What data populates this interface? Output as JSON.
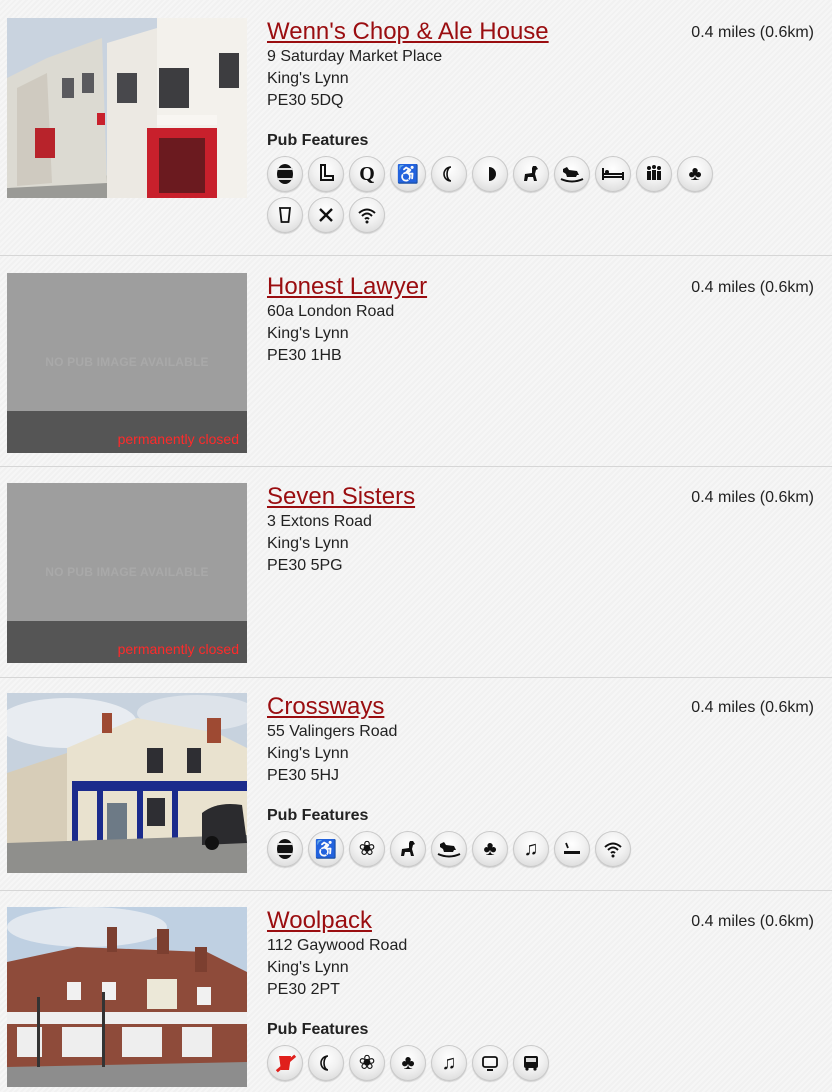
{
  "features_title": "Pub Features",
  "pubs": [
    {
      "name": "Wenn's Chop & Ale House",
      "address1": "9 Saturday Market Place",
      "address2": "King's Lynn",
      "postcode": "PE30 5DQ",
      "distance": "0.4 miles (0.6km)",
      "icons": [
        "cask-ale-icon",
        "boot-icon",
        "quiz-icon",
        "wheelchair-icon",
        "quarter-moon-icon",
        "half-moon-icon",
        "dog-icon",
        "rocking-horse-icon",
        "bed-icon",
        "function-room-icon",
        "club-icon",
        "pint-glass-icon",
        "cutlery-icon",
        "wifi-icon"
      ]
    },
    {
      "name": "Honest Lawyer",
      "address1": "60a London Road",
      "address2": "King's Lynn",
      "postcode": "PE30 1HB",
      "distance": "0.4 miles (0.6km)",
      "no_image": "NO PUB IMAGE AVAILABLE",
      "status": "permanently closed"
    },
    {
      "name": "Seven Sisters",
      "address1": "3 Extons Road",
      "address2": "King's Lynn",
      "postcode": "PE30 5PG",
      "distance": "0.4 miles (0.6km)",
      "no_image": "NO PUB IMAGE AVAILABLE",
      "status": "permanently closed"
    },
    {
      "name": "Crossways",
      "address1": "55 Valingers Road",
      "address2": "King's Lynn",
      "postcode": "PE30 5HJ",
      "distance": "0.4 miles (0.6km)",
      "icons": [
        "cask-ale-icon",
        "wheelchair-icon",
        "flower-icon",
        "dog-icon",
        "rocking-horse-icon",
        "club-icon",
        "music-icon",
        "smoking-icon",
        "wifi-icon"
      ]
    },
    {
      "name": "Woolpack",
      "address1": "112 Gaywood Road",
      "address2": "King's Lynn",
      "postcode": "PE30 2PT",
      "distance": "0.4 miles (0.6km)",
      "icons": [
        "no-real-ale-icon",
        "quarter-moon-icon",
        "flower-icon",
        "club-icon",
        "music-icon",
        "screen-icon",
        "bus-icon"
      ]
    }
  ]
}
